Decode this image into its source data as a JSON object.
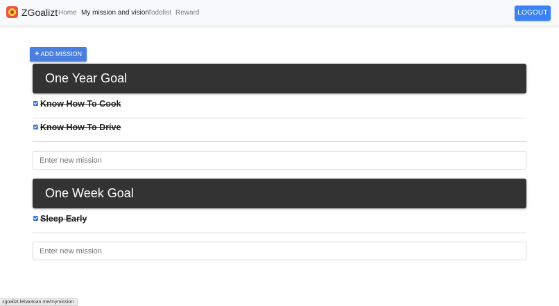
{
  "navbar": {
    "brand": "ZGoalizt",
    "links": [
      {
        "label": "Home",
        "active": false
      },
      {
        "label": "My mission and vision",
        "active": true
      },
      {
        "label": "Todolist",
        "active": false
      },
      {
        "label": "Reward",
        "active": false
      }
    ],
    "logout_label": "LOGOUT"
  },
  "add_mission": {
    "icon": "plus-icon",
    "label": "ADD MISSION"
  },
  "goals": [
    {
      "title": "One Year Goal",
      "missions": [
        {
          "text": "Know How To Cook",
          "done": true
        },
        {
          "text": "Know How To Drive",
          "done": true
        }
      ],
      "input_placeholder": "Enter new mission",
      "input_value": ""
    },
    {
      "title": "One Week Goal",
      "missions": [
        {
          "text": "Sleep Early",
          "done": true
        }
      ],
      "input_placeholder": "Enter new mission",
      "input_value": ""
    }
  ],
  "status_url": "zgoalizt.lebaotoan.me/mymission",
  "colors": {
    "primary_button": "#3b82f6",
    "goal_header_bg": "#333333",
    "navbar_bg": "#f8f9fa"
  }
}
